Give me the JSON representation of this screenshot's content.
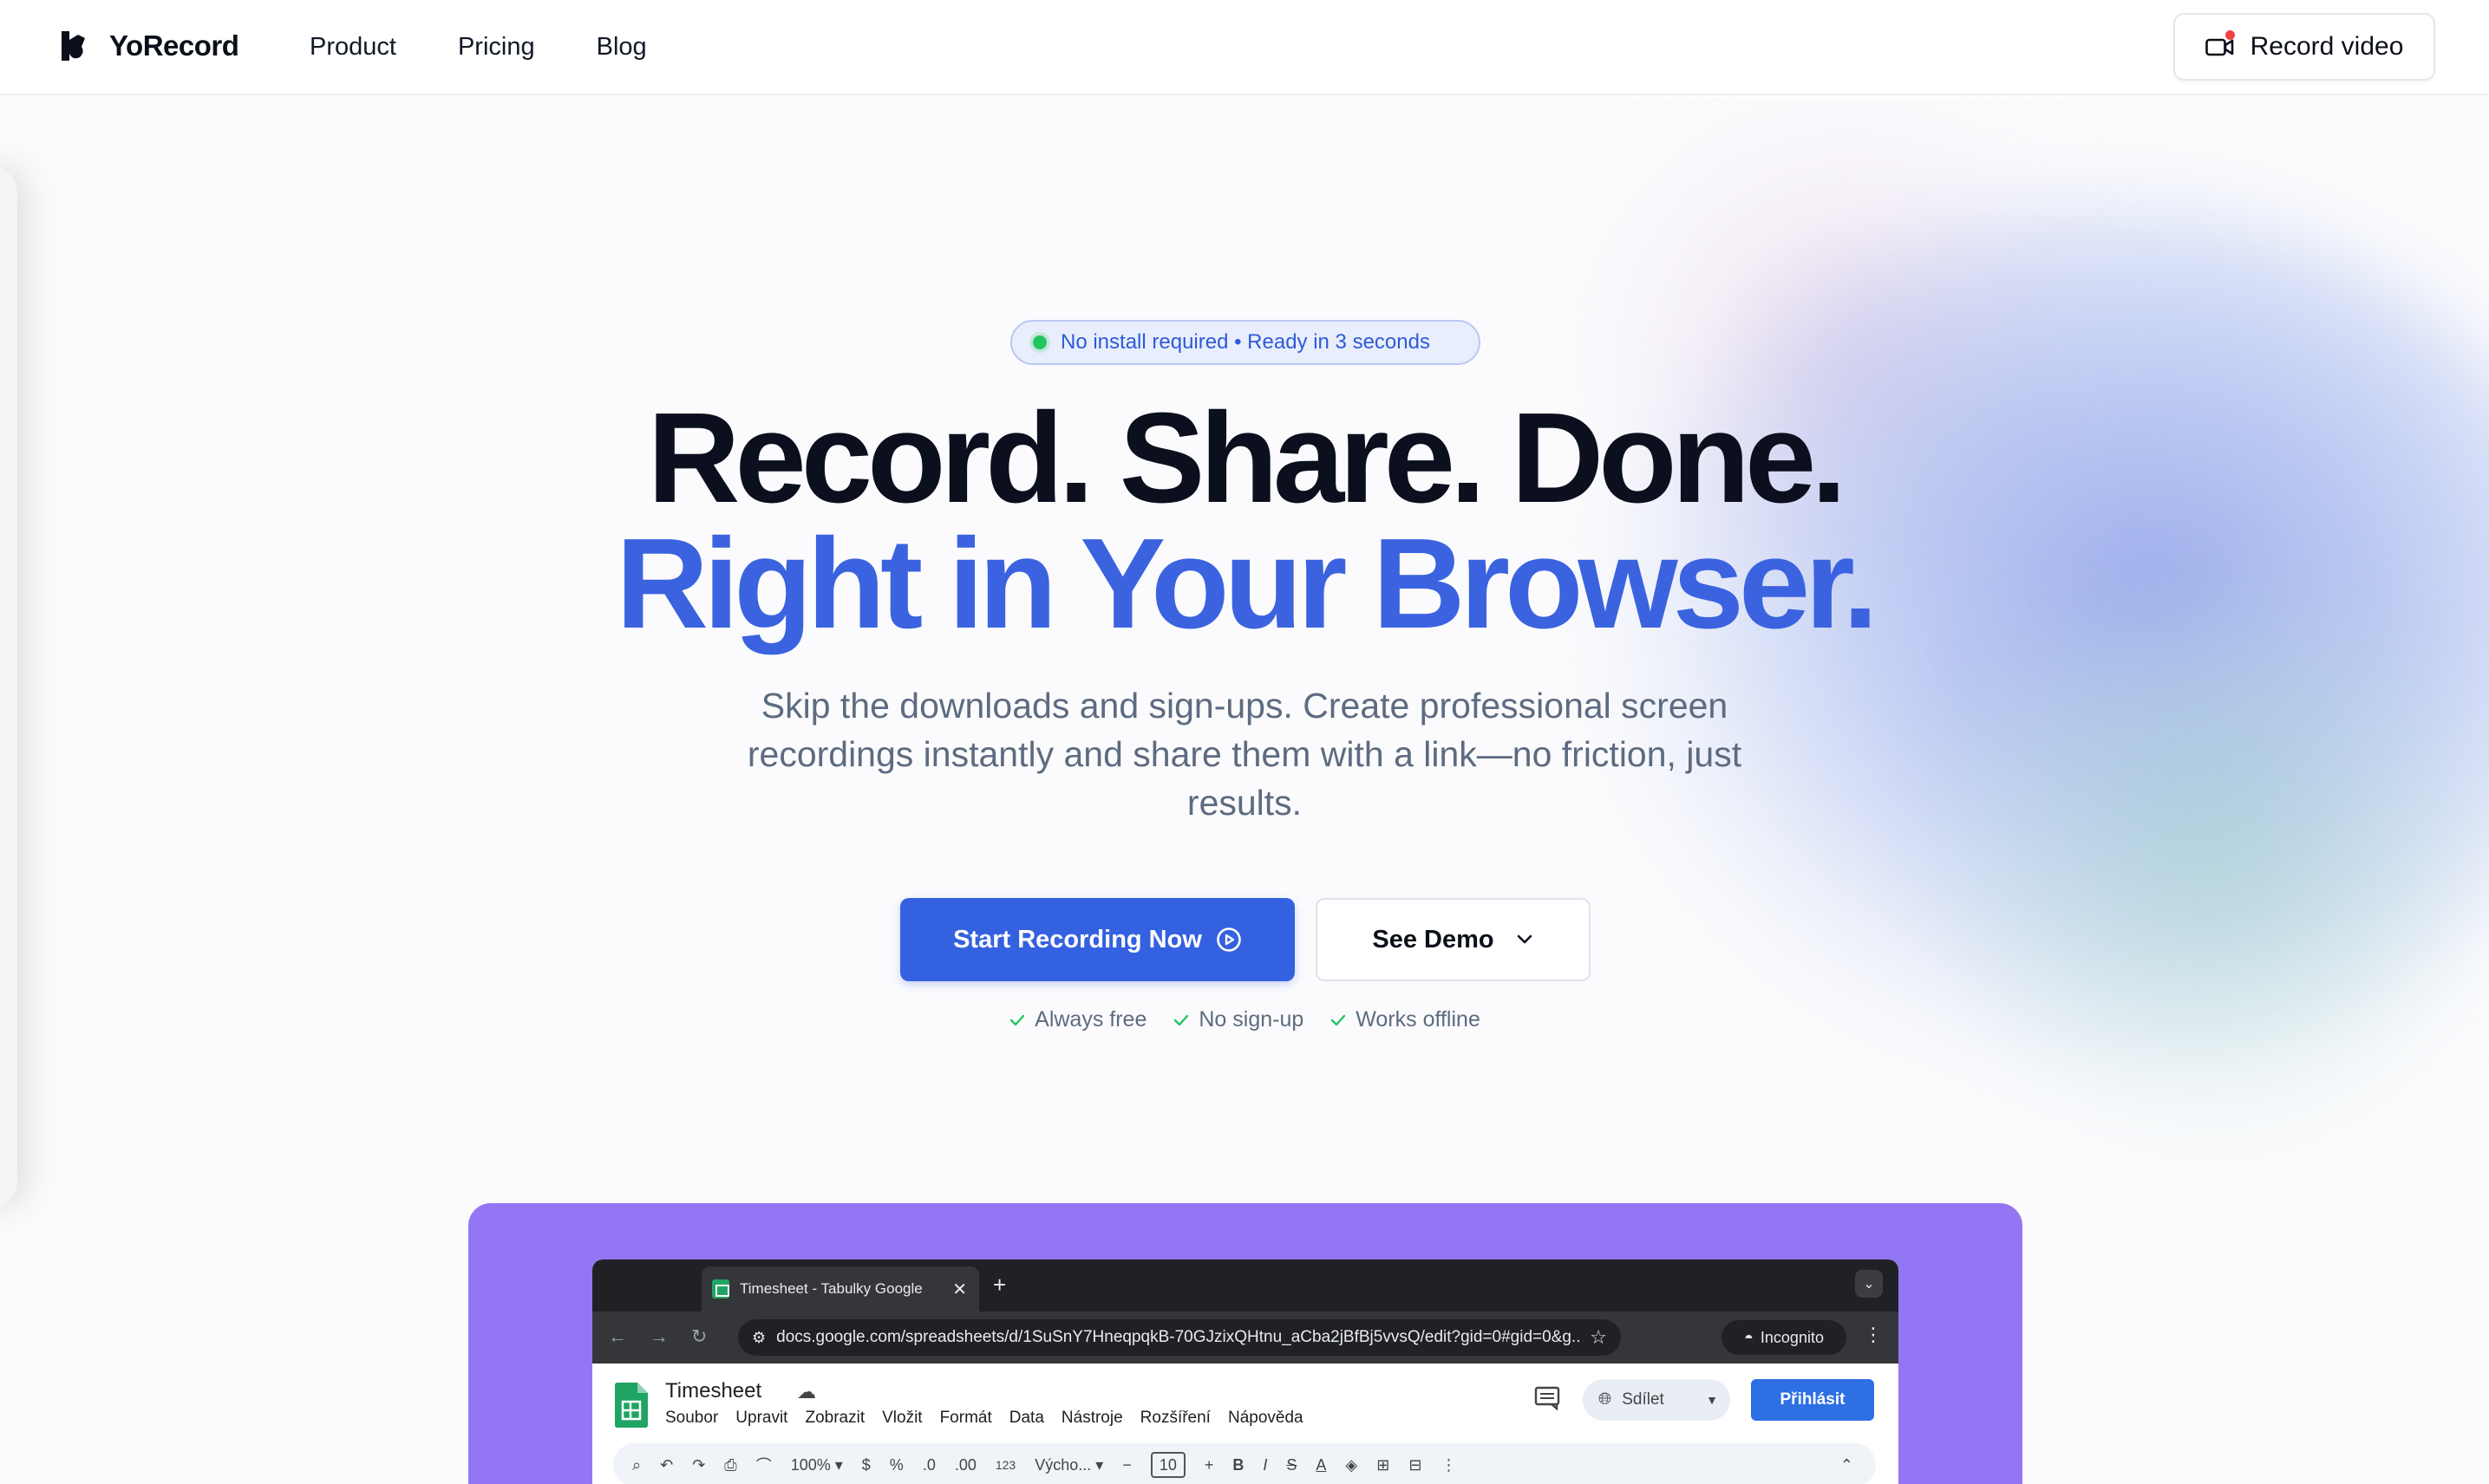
{
  "brand": {
    "name": "YoRecord"
  },
  "nav": {
    "items": [
      "Product",
      "Pricing",
      "Blog"
    ]
  },
  "header": {
    "record_label": "Record video"
  },
  "hero": {
    "pill": "No install required • Ready in 3 seconds",
    "headline_1": "Record. Share. Done.",
    "headline_2": "Right in Your Browser.",
    "subtitle": "Skip the downloads and sign-ups. Create professional screen recordings instantly and share them with a link—no friction, just results.",
    "primary_cta": "Start Recording Now",
    "secondary_cta": "See Demo",
    "checks": [
      "Always free",
      "No sign-up",
      "Works offline"
    ]
  },
  "colors": {
    "accent": "#3461e0",
    "headline_blue": "#3b63e0",
    "demo_bg": "#9376f4",
    "check_green": "#22c55e"
  },
  "demo_browser": {
    "tab_title": "Timesheet - Tabulky Google",
    "url": "docs.google.com/spreadsheets/d/1SuSnY7HneqpqkB-70GJzixQHtnu_aCba2jBfBj5vvsQ/edit?gid=0#gid=0&g...",
    "incognito_label": "Incognito",
    "doc_title": "Timesheet",
    "menus": [
      "Soubor",
      "Upravit",
      "Zobrazit",
      "Vložit",
      "Formát",
      "Data",
      "Nástroje",
      "Rozšíření",
      "Nápověda"
    ],
    "share_label": "Sdílet",
    "signin_label": "Přihlásit",
    "zoom": "100%",
    "currency": "$",
    "percent": "%",
    "dec_less": ".0",
    "dec_more": ".00",
    "num_format": "123",
    "font_name": "Výchо...",
    "font_size": "10"
  }
}
